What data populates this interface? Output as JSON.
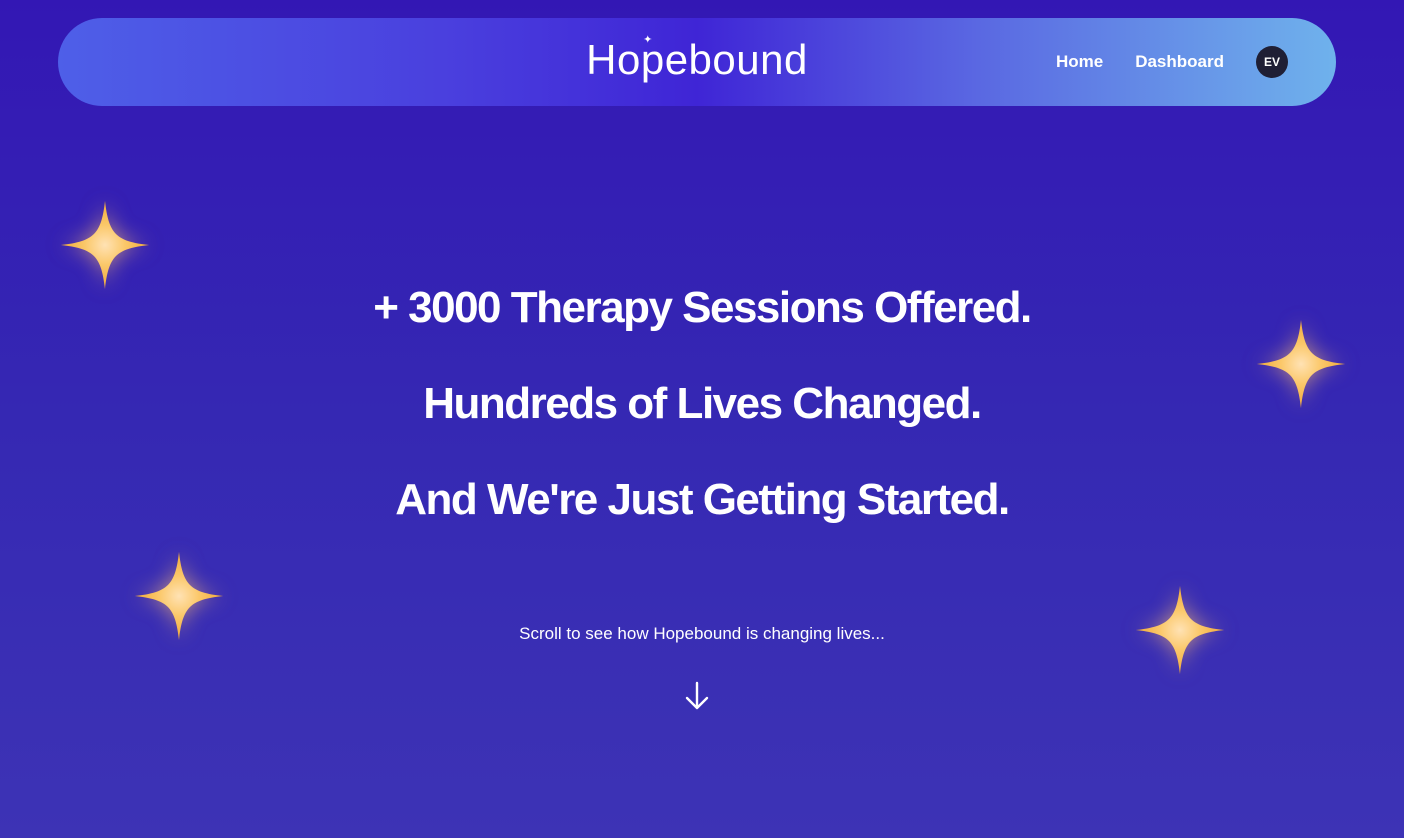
{
  "brand": {
    "logo_text": "Hopebound"
  },
  "nav": {
    "home_label": "Home",
    "dashboard_label": "Dashboard",
    "avatar_initials": "EV"
  },
  "hero": {
    "lines": [
      "+ 3000 Therapy Sessions Offered.",
      "Hundreds of Lives Changed.",
      "And We're Just Getting Started."
    ]
  },
  "scroll": {
    "prompt": "Scroll to see how Hopebound is changing lives...",
    "icon": "arrow-down-icon"
  },
  "decor": {
    "icon": "sparkle-icon"
  },
  "colors": {
    "background_top": "#3317b4",
    "background_bottom": "#3d33b5",
    "navbar_start": "#4e5fe8",
    "navbar_mid": "#3f25d6",
    "navbar_end": "#6fb2ec",
    "avatar_bg": "#1f1f35",
    "sparkle": "#f5b948"
  }
}
